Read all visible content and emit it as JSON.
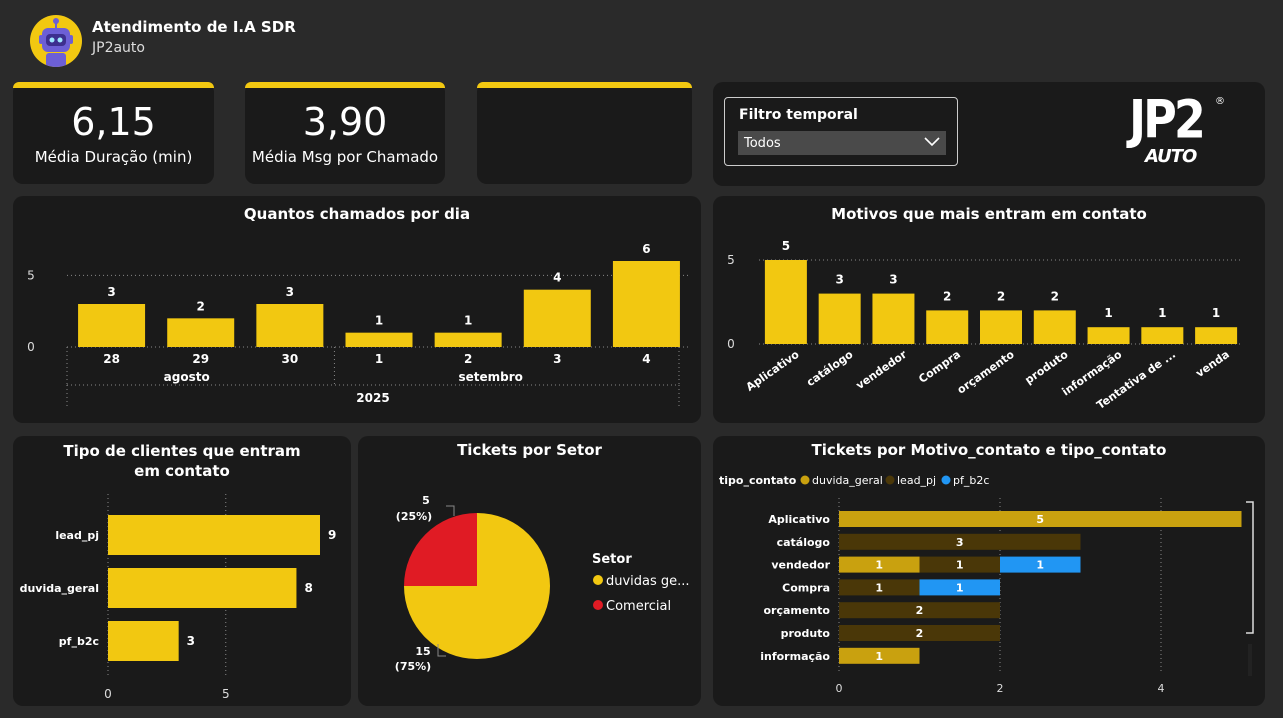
{
  "header": {
    "title": "Atendimento de I.A SDR",
    "subtitle": "JP2auto"
  },
  "kpis": [
    {
      "value": "6,15",
      "label": "Média Duração (min)"
    },
    {
      "value": "3,90",
      "label": "Média Msg por Chamado"
    },
    {
      "value": "",
      "label": ""
    }
  ],
  "filter": {
    "label": "Filtro temporal",
    "value": "Todos"
  },
  "logo": {
    "text_main": "JP2",
    "text_sub": "AUTO",
    "mark": "®"
  },
  "colors": {
    "yellow": "#f2c811",
    "gold": "#c9a10f",
    "brown": "#4a3708",
    "blue": "#2196f3",
    "red": "#e01b24"
  },
  "chart_data": [
    {
      "type": "bar",
      "title": "Quantos chamados por dia",
      "categories": [
        "28",
        "29",
        "30",
        "1",
        "2",
        "3",
        "4"
      ],
      "values": [
        3,
        2,
        3,
        1,
        1,
        4,
        6
      ],
      "month_labels": [
        "agosto",
        "setembro"
      ],
      "year_label": "2025",
      "yticks": [
        "5",
        "0"
      ],
      "ylim": [
        0,
        6
      ]
    },
    {
      "type": "bar",
      "title": "Motivos que mais entram em contato",
      "categories": [
        "Aplicativo",
        "catálogo",
        "vendedor",
        "Compra",
        "orçamento",
        "produto",
        "informação",
        "Tentativa de ...",
        "venda"
      ],
      "values": [
        5,
        3,
        3,
        2,
        2,
        2,
        1,
        1,
        1
      ],
      "yticks": [
        "5",
        "0"
      ],
      "ylim": [
        0,
        5
      ]
    },
    {
      "type": "bar",
      "orientation": "horizontal",
      "title": "Tipo de clientes que entram em contato",
      "categories": [
        "lead_pj",
        "duvida_geral",
        "pf_b2c"
      ],
      "values": [
        9,
        8,
        3
      ],
      "xticks": [
        "0",
        "5"
      ],
      "xlim": [
        0,
        10
      ]
    },
    {
      "type": "pie",
      "title": "Tickets por Setor",
      "legend_title": "Setor",
      "slices": [
        {
          "name": "duvidas ge...",
          "value": 15,
          "label_count": "15",
          "label_pct": "(75%)"
        },
        {
          "name": "Comercial",
          "value": 5,
          "label_count": "5",
          "label_pct": "(25%)"
        }
      ]
    },
    {
      "type": "bar",
      "orientation": "horizontal",
      "stacked": true,
      "title": "Tickets por Motivo_contato e tipo_contato",
      "legend_title": "tipo_contato",
      "series_names": [
        "duvida_geral",
        "lead_pj",
        "pf_b2c"
      ],
      "categories": [
        "Aplicativo",
        "catálogo",
        "vendedor",
        "Compra",
        "orçamento",
        "produto",
        "informação"
      ],
      "segments": [
        [
          {
            "series": "duvida_geral",
            "value": 5
          }
        ],
        [
          {
            "series": "lead_pj",
            "value": 3
          }
        ],
        [
          {
            "series": "duvida_geral",
            "value": 1
          },
          {
            "series": "lead_pj",
            "value": 1
          },
          {
            "series": "pf_b2c",
            "value": 1
          }
        ],
        [
          {
            "series": "lead_pj",
            "value": 1
          },
          {
            "series": "pf_b2c",
            "value": 1
          }
        ],
        [
          {
            "series": "lead_pj",
            "value": 2
          }
        ],
        [
          {
            "series": "lead_pj",
            "value": 2
          }
        ],
        [
          {
            "series": "duvida_geral",
            "value": 1
          }
        ]
      ],
      "xticks": [
        "0",
        "2",
        "4"
      ],
      "xlim": [
        0,
        5
      ]
    }
  ]
}
